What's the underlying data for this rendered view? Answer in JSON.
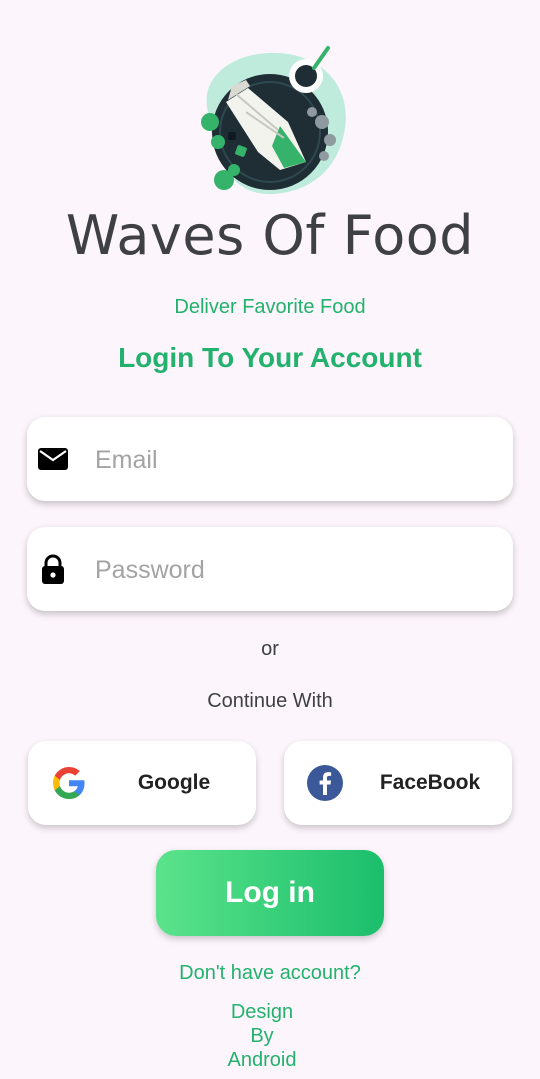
{
  "app": {
    "title": "Waves Of Food",
    "tagline": "Deliver Favorite Food",
    "heading": "Login To Your  Account"
  },
  "form": {
    "email": {
      "placeholder": "Email",
      "value": "",
      "icon": "mail-icon"
    },
    "password": {
      "placeholder": "Password",
      "value": "",
      "icon": "lock-icon"
    }
  },
  "divider": {
    "or": "or",
    "continue_with": "Continue With"
  },
  "social": {
    "google": {
      "label": "Google",
      "icon": "google-icon"
    },
    "facebook": {
      "label": "FaceBook",
      "icon": "facebook-icon"
    }
  },
  "login_button": {
    "label": "Log in"
  },
  "footer": {
    "signup_link": "Don't have account?",
    "credit_line1": "Design By",
    "credit_line2": "Android"
  },
  "colors": {
    "background": "#FCF5FB",
    "accent_green": "#23B26D",
    "button_gradient_start": "#5BE38B",
    "button_gradient_end": "#1BBE6C",
    "title_dark": "#3F3F46",
    "facebook_blue": "#3B5998"
  }
}
